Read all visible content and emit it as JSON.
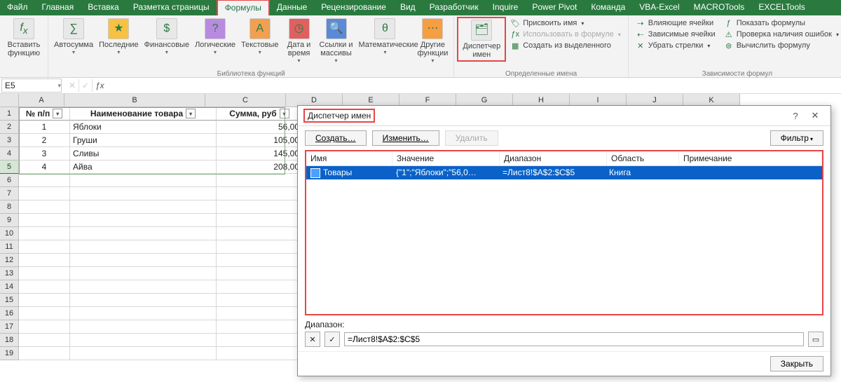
{
  "tabs": {
    "file": "Файл",
    "home": "Главная",
    "insert": "Вставка",
    "layout": "Разметка страницы",
    "formulas": "Формулы",
    "data": "Данные",
    "review": "Рецензирование",
    "view": "Вид",
    "developer": "Разработчик",
    "inquire": "Inquire",
    "powerpivot": "Power Pivot",
    "team": "Команда",
    "vbaexcel": "VBA-Excel",
    "macrotools": "MACROTools",
    "exceltools": "EXCELTools"
  },
  "ribbon": {
    "insert_fn": "Вставить\nфункцию",
    "autosum": "Автосумма",
    "recent": "Последние",
    "financial": "Финансовые",
    "logical": "Логические",
    "text": "Текстовые",
    "datetime": "Дата и\nвремя",
    "lookup": "Ссылки и\nмассивы",
    "math": "Математические",
    "more": "Другие\nфункции",
    "name_mgr": "Диспетчер\nимен",
    "grp_lib": "Библиотека функций",
    "define_name": "Присвоить имя",
    "use_in_formula": "Использовать в формуле",
    "create_from_sel": "Создать из выделенного",
    "grp_names": "Определенные имена",
    "trace_prec": "Влияющие ячейки",
    "trace_dep": "Зависимые ячейки",
    "remove_arrows": "Убрать стрелки",
    "show_formulas": "Показать формулы",
    "error_check": "Проверка наличия ошибок",
    "evaluate": "Вычислить формулу",
    "grp_dep": "Зависимости формул"
  },
  "namebox": "E5",
  "table": {
    "headers": {
      "a": "№ п/п",
      "b": "Наименование товара",
      "c": "Сумма, руб"
    },
    "rows": [
      {
        "n": "1",
        "name": "Яблоки",
        "sum": "56,00"
      },
      {
        "n": "2",
        "name": "Груши",
        "sum": "105,00"
      },
      {
        "n": "3",
        "name": "Сливы",
        "sum": "145,00"
      },
      {
        "n": "4",
        "name": "Айва",
        "sum": "208,00"
      }
    ]
  },
  "cols": [
    "A",
    "B",
    "C",
    "D",
    "E",
    "F",
    "G",
    "H",
    "I",
    "J",
    "K"
  ],
  "rownums": [
    "1",
    "2",
    "3",
    "4",
    "5",
    "6",
    "7",
    "8",
    "9",
    "10",
    "11",
    "12",
    "13",
    "14",
    "15",
    "16",
    "17",
    "18",
    "19"
  ],
  "dialog": {
    "title": "Диспетчер имен",
    "create": "Создать…",
    "edit": "Изменить…",
    "delete": "Удалить",
    "filter": "Фильтр",
    "cols": {
      "name": "Имя",
      "value": "Значение",
      "range": "Диапазон",
      "scope": "Область",
      "comment": "Примечание"
    },
    "row": {
      "name": "Товары",
      "value": "{\"1\";\"Яблоки\";\"56,0…",
      "range": "=Лист8!$A$2:$C$5",
      "scope": "Книга",
      "comment": ""
    },
    "range_label": "Диапазон:",
    "range_value": "=Лист8!$A$2:$C$5",
    "close": "Закрыть"
  }
}
